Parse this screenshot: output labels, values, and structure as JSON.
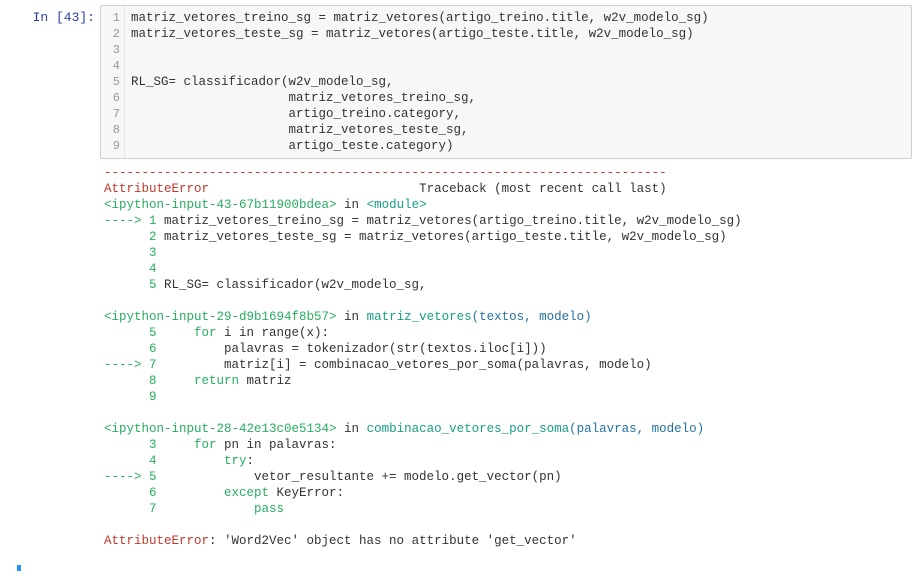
{
  "cell": {
    "prompt": "In [43]:",
    "gutter": [
      "1",
      "2",
      "3",
      "4",
      "5",
      "6",
      "7",
      "8",
      "9"
    ],
    "code_lines": [
      "matriz_vetores_treino_sg = matriz_vetores(artigo_treino.title, w2v_modelo_sg)",
      "matriz_vetores_teste_sg = matriz_vetores(artigo_teste.title, w2v_modelo_sg)",
      "",
      "",
      "RL_SG= classificador(w2v_modelo_sg,",
      "                     matriz_vetores_treino_sg,",
      "                     artigo_treino.category,",
      "                     matriz_vetores_teste_sg,",
      "                     artigo_teste.category)"
    ]
  },
  "output": {
    "dashes": "---------------------------------------------------------------------------",
    "error_name": "AttributeError",
    "traceback_label": "                            Traceback (most recent call last)",
    "frame1": {
      "loc_pre": "<ipython-input-43-67b11900bdea>",
      "loc_in": " in ",
      "loc_fn": "<module>",
      "l1_arrow": "----> 1 ",
      "l1": "matriz_vetores_treino_sg = matriz_vetores(artigo_treino.title, w2v_modelo_sg)",
      "l2_pre": "      2 ",
      "l2": "matriz_vetores_teste_sg = matriz_vetores(artigo_teste.title, w2v_modelo_sg)",
      "l3": "      3 ",
      "l4": "      4 ",
      "l5_pre": "      5 ",
      "l5": "RL_SG= classificador(w2v_modelo_sg,"
    },
    "frame2": {
      "loc_pre": "<ipython-input-29-d9b1694f8b57>",
      "loc_in": " in ",
      "loc_fn": "matriz_vetores",
      "loc_args": "(textos, modelo)",
      "l5_pre": "      5     ",
      "l5_kw": "for",
      "l5_rest": " i in range(x):",
      "l6_pre": "      6         ",
      "l6": "palavras = tokenizador(str(textos.iloc[i]))",
      "l7_arrow": "----> 7         ",
      "l7": "matriz[i] = combinacao_vetores_por_soma(palavras, modelo)",
      "l8_pre": "      8     ",
      "l8_kw": "return",
      "l8_rest": " matriz",
      "l9": "      9 "
    },
    "frame3": {
      "loc_pre": "<ipython-input-28-42e13c0e5134>",
      "loc_in": " in ",
      "loc_fn": "combinacao_vetores_por_soma",
      "loc_args": "(palavras, modelo)",
      "l3_pre": "      3     ",
      "l3_kw": "for",
      "l3_rest": " pn in palavras:",
      "l4_pre": "      4         ",
      "l4_kw": "try",
      "l4_rest": ":",
      "l5_arrow": "----> 5             ",
      "l5": "vetor_resultante += modelo.get_vector(pn)",
      "l6_pre": "      6         ",
      "l6_kw": "except",
      "l6_mid": " KeyError",
      "l6_rest": ":",
      "l7_pre": "      7             ",
      "l7_kw": "pass"
    },
    "final_error_name": "AttributeError",
    "final_error_msg": ": 'Word2Vec' object has no attribute 'get_vector'"
  }
}
